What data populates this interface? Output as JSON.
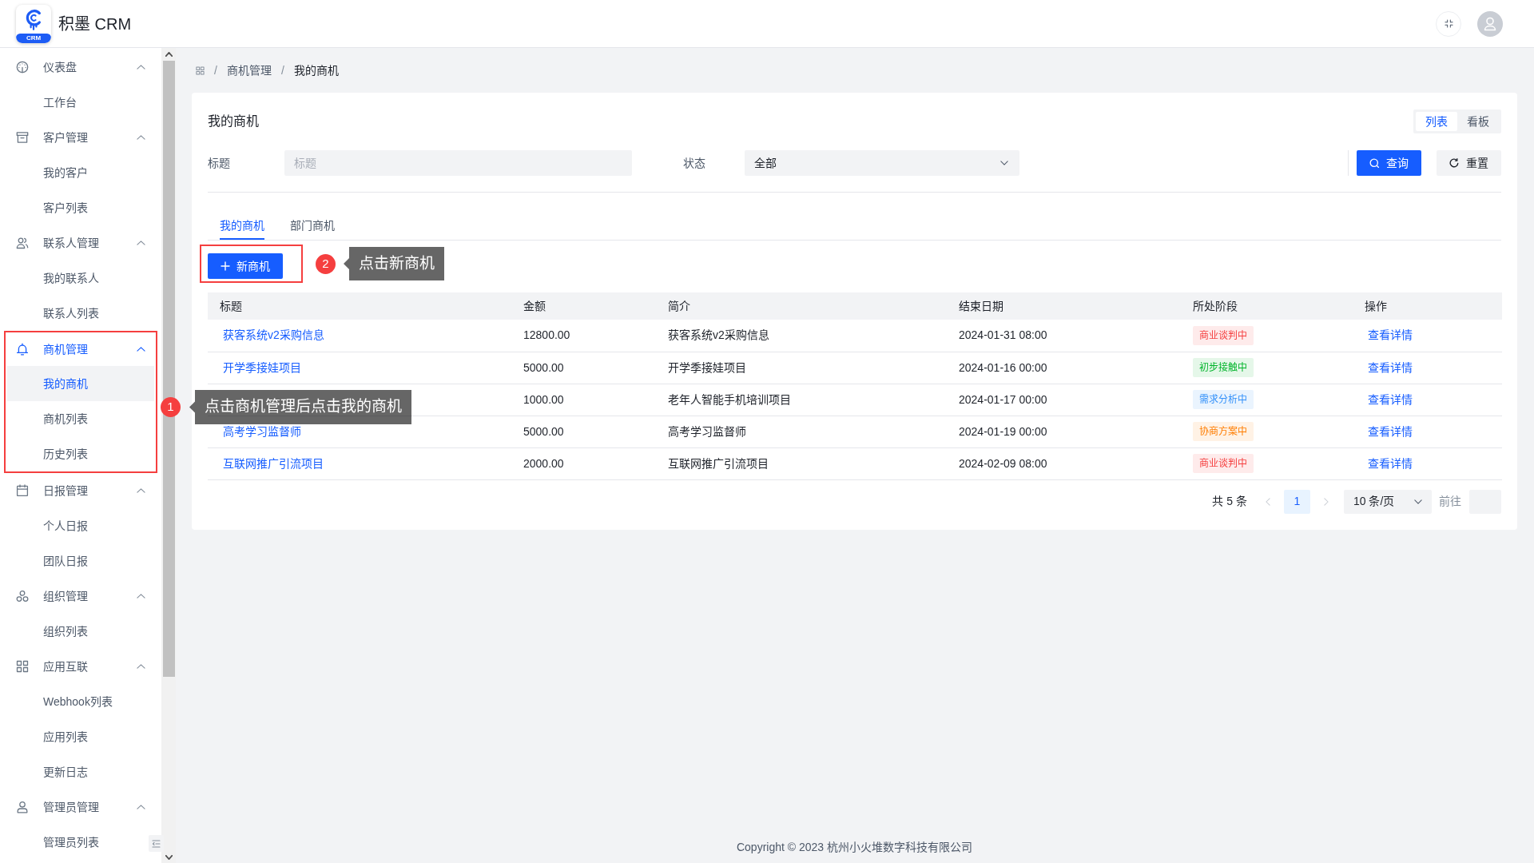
{
  "header": {
    "logo_text": "CRM",
    "app_name": "积墨 CRM"
  },
  "sidebar": {
    "groups": [
      {
        "label": "仪表盘",
        "expanded": true,
        "selected": false,
        "highlighted": false,
        "items": [
          {
            "label": "工作台",
            "selected": false
          }
        ]
      },
      {
        "label": "客户管理",
        "expanded": true,
        "selected": false,
        "highlighted": false,
        "items": [
          {
            "label": "我的客户",
            "selected": false
          },
          {
            "label": "客户列表",
            "selected": false
          }
        ]
      },
      {
        "label": "联系人管理",
        "expanded": true,
        "selected": false,
        "highlighted": false,
        "items": [
          {
            "label": "我的联系人",
            "selected": false
          },
          {
            "label": "联系人列表",
            "selected": false
          }
        ]
      },
      {
        "label": "商机管理",
        "expanded": true,
        "selected": true,
        "highlighted": true,
        "annotation": {
          "number": "1",
          "text": "点击商机管理后点击我的商机"
        },
        "items": [
          {
            "label": "我的商机",
            "selected": true
          },
          {
            "label": "商机列表",
            "selected": false
          },
          {
            "label": "历史列表",
            "selected": false
          }
        ]
      },
      {
        "label": "日报管理",
        "expanded": true,
        "selected": false,
        "highlighted": false,
        "items": [
          {
            "label": "个人日报",
            "selected": false
          },
          {
            "label": "团队日报",
            "selected": false
          }
        ]
      },
      {
        "label": "组织管理",
        "expanded": true,
        "selected": false,
        "highlighted": false,
        "items": [
          {
            "label": "组织列表",
            "selected": false
          }
        ]
      },
      {
        "label": "应用互联",
        "expanded": true,
        "selected": false,
        "highlighted": false,
        "items": [
          {
            "label": "Webhook列表",
            "selected": false
          },
          {
            "label": "应用列表",
            "selected": false
          },
          {
            "label": "更新日志",
            "selected": false
          }
        ]
      },
      {
        "label": "管理员管理",
        "expanded": true,
        "selected": false,
        "highlighted": false,
        "items": [
          {
            "label": "管理员列表",
            "selected": false
          }
        ]
      }
    ]
  },
  "breadcrumb": {
    "separator": "/",
    "items": [
      "商机管理",
      "我的商机"
    ]
  },
  "card": {
    "title": "我的商机",
    "views": [
      {
        "label": "列表",
        "selected": true
      },
      {
        "label": "看板",
        "selected": false
      }
    ],
    "filters": [
      {
        "label": "标题",
        "kind": "input",
        "placeholder": "标题"
      },
      {
        "label": "状态",
        "kind": "select",
        "value": "全部"
      }
    ],
    "actions": [
      {
        "label": "查询",
        "kind": "primary"
      },
      {
        "label": "重置",
        "kind": "reset"
      }
    ],
    "tabs": [
      {
        "label": "我的商机",
        "selected": true
      },
      {
        "label": "部门商机",
        "selected": false
      }
    ],
    "new_button": {
      "label": "新商机",
      "highlighted": true,
      "annotation": {
        "number": "2",
        "text": "点击新商机"
      }
    },
    "table": {
      "columns": [
        "标题",
        "金额",
        "简介",
        "结束日期",
        "所处阶段",
        "操作"
      ],
      "rows": [
        {
          "title": "获客系统v2采购信息",
          "amount": "12800.00",
          "summary": "获客系统v2采购信息",
          "end_date": "2024-01-31 08:00",
          "stage": {
            "label": "商业谈判中",
            "color": "#f53f3f"
          },
          "action": "查看详情"
        },
        {
          "title": "开学季接娃项目",
          "amount": "5000.00",
          "summary": "开学季接娃项目",
          "end_date": "2024-01-16 00:00",
          "stage": {
            "label": "初步接触中",
            "color": "#00b42a"
          },
          "action": "查看详情"
        },
        {
          "amount": "1000.00",
          "summary": "老年人智能手机培训项目",
          "end_date": "2024-01-17 00:00",
          "stage": {
            "label": "需求分析中",
            "color": "#3491fa"
          },
          "action": "查看详情"
        },
        {
          "title": "高考学习监督师",
          "amount": "5000.00",
          "summary": "高考学习监督师",
          "end_date": "2024-01-19 00:00",
          "stage": {
            "label": "协商方案中",
            "color": "#ff7d00"
          },
          "action": "查看详情"
        },
        {
          "title": "互联网推广引流项目",
          "amount": "2000.00",
          "summary": "互联网推广引流项目",
          "end_date": "2024-02-09 08:00",
          "stage": {
            "label": "商业谈判中",
            "color": "#f53f3f"
          },
          "action": "查看详情"
        }
      ]
    },
    "pagination": {
      "total": "共 5 条",
      "prev_disabled": true,
      "pages": [
        {
          "label": "1",
          "selected": true
        }
      ],
      "next_disabled": true,
      "page_size": "10 条/页",
      "goto_label": "前往"
    }
  },
  "footer": "Copyright © 2023 杭州小火堆数字科技有限公司"
}
